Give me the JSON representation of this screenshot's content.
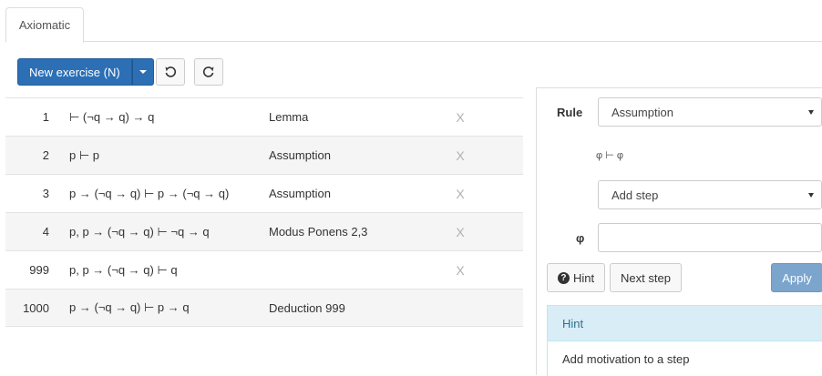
{
  "tabs": [
    {
      "label": "Axiomatic",
      "active": true
    }
  ],
  "toolbar": {
    "new_exercise_label": "New exercise (N)",
    "undo_icon": "undo-icon",
    "redo_icon": "redo-icon"
  },
  "proof": {
    "rows": [
      {
        "num": "1",
        "formula": "⊢ (¬q → q) → q",
        "rule": "Lemma",
        "delete": "X"
      },
      {
        "num": "2",
        "formula": "p ⊢ p",
        "rule": "Assumption",
        "delete": "X"
      },
      {
        "num": "3",
        "formula": "p → (¬q → q) ⊢ p → (¬q → q)",
        "rule": "Assumption",
        "delete": "X"
      },
      {
        "num": "4",
        "formula": "p, p → (¬q → q) ⊢ ¬q → q",
        "rule": "Modus Ponens 2,3",
        "delete": "X"
      },
      {
        "num": "999",
        "formula": "p, p → (¬q → q) ⊢ q",
        "rule": "",
        "delete": "X"
      },
      {
        "num": "1000",
        "formula": "p → (¬q → q) ⊢ p → q",
        "rule": "Deduction 999",
        "delete": ""
      }
    ]
  },
  "panel": {
    "rule_label": "Rule",
    "rule_selected": "Assumption",
    "rule_description": "φ ⊢ φ",
    "step_selected": "Add step",
    "phi_label": "φ",
    "phi_value": "",
    "hint_button": "Hint",
    "next_step_button": "Next step",
    "apply_button": "Apply",
    "hint_title": "Hint",
    "hint_text": "Add motivation to a step"
  },
  "colors": {
    "primary": "#2c6fb5",
    "apply_disabled": "#7ba5cd",
    "hint_bg": "#d9edf7",
    "hint_text": "#31708f"
  }
}
